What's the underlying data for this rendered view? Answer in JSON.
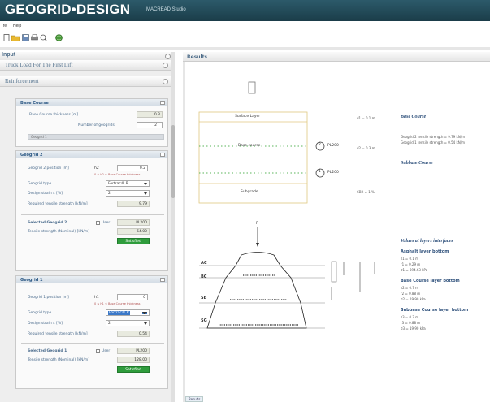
{
  "app": {
    "title": "GEOGRID•DESIGN",
    "subtitle": "MACREAD Studio"
  },
  "menu": {
    "file": "fe",
    "help": "Help"
  },
  "left": {
    "header": "Input",
    "collapsed_section": "Truck Load For The First Lift",
    "reinforcement": "Reinforcement",
    "base_course": {
      "title": "Base Course",
      "thickness_label": "Base Course thickness [m]",
      "thickness_value": "0.3",
      "num_geogrids_label": "Number of geogrids",
      "num_geogrids_value": "2",
      "geogrid_subheader": "Geogrid 1"
    },
    "geogrid2": {
      "title": "Geogrid 2",
      "elevation_label": "Geogrid 2 position [m]",
      "elevation_symbol": "h2",
      "elevation_value": "0.2",
      "hint": "0 < h2 ≤ Base Course thickness",
      "type_label": "Geogrid type",
      "type_value": "Fortrac® R",
      "strain_label": "Design strain ε [%]",
      "strain_value": "2",
      "required_label": "Required tensile strength [kN/m]",
      "required_value": "9.79",
      "selected_label": "Selected Geogrid 2",
      "selected_value": "PL200",
      "tensile_label": "Tensile strength (Nominal) [kN/m]",
      "tensile_value": "64.00",
      "status": "Satisfied"
    },
    "geogrid1": {
      "title": "Geogrid 1",
      "elevation_label": "Geogrid 1 position [m]",
      "elevation_symbol": "h1",
      "elevation_value": "0",
      "hint": "0 ≤ h1 < Base Course thickness",
      "type_label": "Geogrid type",
      "type_value": "Fortrac® R",
      "strain_label": "Design strain ε [%]",
      "strain_value": "2",
      "required_label": "Required tensile strength [kN/m]",
      "required_value": "0.54",
      "selected_label": "Selected Geogrid 1",
      "selected_value": "PL200",
      "tensile_label": "Tensile strength (Nominal) [kN/m]",
      "tensile_value": "128.00",
      "status": "Satisfied",
      "user_label": "User"
    }
  },
  "right": {
    "header": "Results",
    "bottom_tab": "Results",
    "diagram1": {
      "surface": "Surface Layer",
      "base": "Base course",
      "subgrade": "Subgrade",
      "pl_top": "PL200",
      "pl_bottom": "PL200",
      "num_top": "2",
      "num_bottom": "1",
      "right1": "d1 = 0.1 m",
      "right2": "d2 = 0.3 m",
      "right3": "CBR = 1 %"
    },
    "base_course_title": "Base Course",
    "base_course_lines": [
      "Geogrid 2 tensile strength = 9.79 kN/m",
      "Geogrid 1 tensile strength = 0.54 kN/m"
    ],
    "subbase_title": "Subbase Course",
    "diagram2": {
      "ac": "AC",
      "bc": "BC",
      "sb": "SB",
      "sg": "SG",
      "p": "P"
    },
    "values_title": "Values at layers interfaces",
    "asphalt_title": "Asphalt layer bottom",
    "asphalt_lines": [
      "z1 = 0.1 m",
      "r1 = 0.29 m",
      "σ1 = 394.63 kPa"
    ],
    "basecourse_bottom_title": "Base Course layer bottom",
    "basecourse_bottom_lines": [
      "z2 = 0.7 m",
      "r2 = 0.88 m",
      "σ2 = 19.90 kPa"
    ],
    "subbase_bottom_title": "Subbase Course layer bottom",
    "subbase_bottom_lines": [
      "z3 = 0.7 m",
      "r3 = 0.88 m",
      "σ3 = 19.90 kPa"
    ]
  },
  "colors": {
    "titlebar": "#1b3d49",
    "satisfied": "#2f9c3c",
    "accent": "#2d4f7a"
  }
}
